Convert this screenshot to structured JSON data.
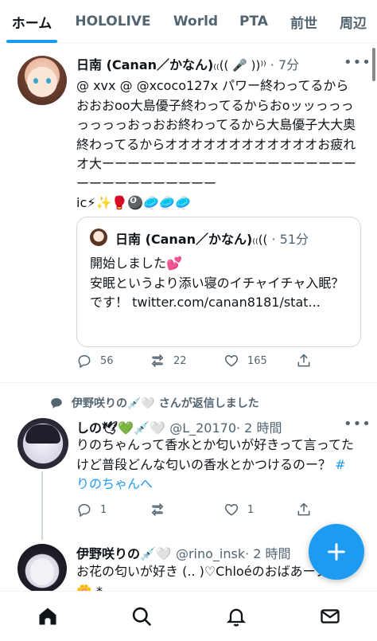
{
  "tabs": [
    {
      "label": "ホーム",
      "active": true
    },
    {
      "label": "HOLOLIVE"
    },
    {
      "label": "World"
    },
    {
      "label": "PTA"
    },
    {
      "label": "前世"
    },
    {
      "label": "周辺"
    }
  ],
  "tweet1": {
    "display_name": "日南 (Canan／かなん)",
    "name_decor": "₍₍(( 🎤 ))⁾⁾",
    "time": "· 7分",
    "body_mentions": "@ xvx @ @xcoco127x",
    "body_text": " パワー終わってるからおおおoo大島優子終わってるからおoッッっっっっっっっおっおお終わってるから大島優子大大奥終わってるからオオオオオオオオオオオオお疲れオ大ーーーーーーーーーーーーーーーーーーーーーーーーーーーーーーー",
    "body_tail": "ic⚡✨🥊🎱🥏🥏🥏",
    "quote": {
      "display_name": "日南 (Canan／かなん)",
      "name_decor": "₍₍((",
      "time": "· 51分",
      "line1": "開始しました💕",
      "line2": "安眠というより添い寝のイチャイチャ入眠？です！ twitter.com/canan8181/stat..."
    },
    "stats": {
      "replies": "56",
      "retweets": "22",
      "likes": "165"
    }
  },
  "reply_banner": "伊野咲りの💉🤍 さんが返信しました",
  "tweet2": {
    "display_name": "しの🕊💚💉🤍",
    "handle": "@L_20170",
    "time": "· 2 時間",
    "body_text": "りのちゃんって香水とか匂いが好きって言ってたけど普段どんな匂いの香水とかつけるのー？ ",
    "hashtag": "#りのちゃんへ",
    "stats": {
      "replies": "1",
      "retweets": "",
      "likes": "1"
    }
  },
  "tweet3": {
    "display_name": "伊野咲りの💉🤍",
    "handle": "@rino_insk",
    "time": "· 2 時間",
    "body_text": "お花の匂いが好き (.. )♡Chloéのおばあーブ好き🌼 *"
  },
  "icons": {
    "more": "more-icon",
    "reply": "reply-icon",
    "retweet": "retweet-icon",
    "like": "heart-icon",
    "share": "share-icon",
    "compose": "plus-icon",
    "home": "home-icon",
    "search": "search-icon",
    "notifications": "bell-icon",
    "messages": "mail-icon"
  },
  "colors": {
    "accent": "#1d9bf0",
    "text": "#0f1419",
    "muted": "#536471"
  }
}
